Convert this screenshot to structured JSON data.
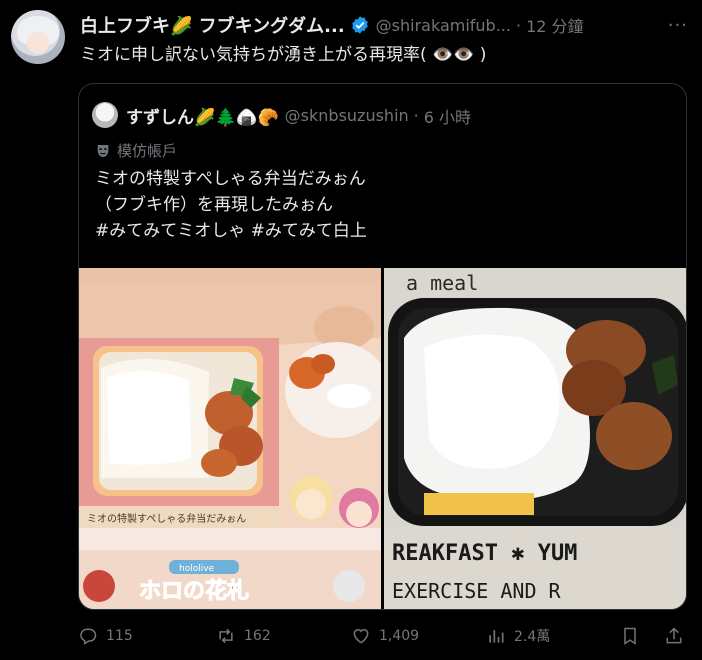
{
  "post": {
    "author_name": "白上フブキ🌽 フブキングダム...",
    "handle": "@shirakamifub...",
    "separator": "·",
    "time": "12 分鐘",
    "more": "···",
    "text": "ミオに申し訳ない気持ちが湧き上がる再現率( 👁️👁️ )"
  },
  "quote": {
    "author_name": "すずしん🌽🌲🍙🥐",
    "handle": "@sknbsuzushin",
    "separator": "·",
    "time": "6 小時",
    "parody_label": "模仿帳戶",
    "text_lines": [
      "ミオの特製すぺしゃる弁当だみぉん",
      "（フブキ作）を再現したみぉん",
      "#みてみてミオしゃ #みてみて白上"
    ],
    "image_left": {
      "caption": "ミオの特製すぺしゃる弁当だみぉん",
      "logo_small": "hololive",
      "logo_main": "ホロの花札"
    },
    "image_right": {
      "text_top": "a meal",
      "text_mid": "REAKFAST ✱ YUM",
      "text_bottom": "EXERCISE AND R"
    }
  },
  "actions": {
    "reply_count": "115",
    "retweet_count": "162",
    "like_count": "1,409",
    "view_count": "2.4萬"
  },
  "colors": {
    "background": "#000000",
    "text": "#e7e9ea",
    "muted": "#71767b",
    "verified": "#1d9bf0",
    "border": "#2f3336"
  }
}
